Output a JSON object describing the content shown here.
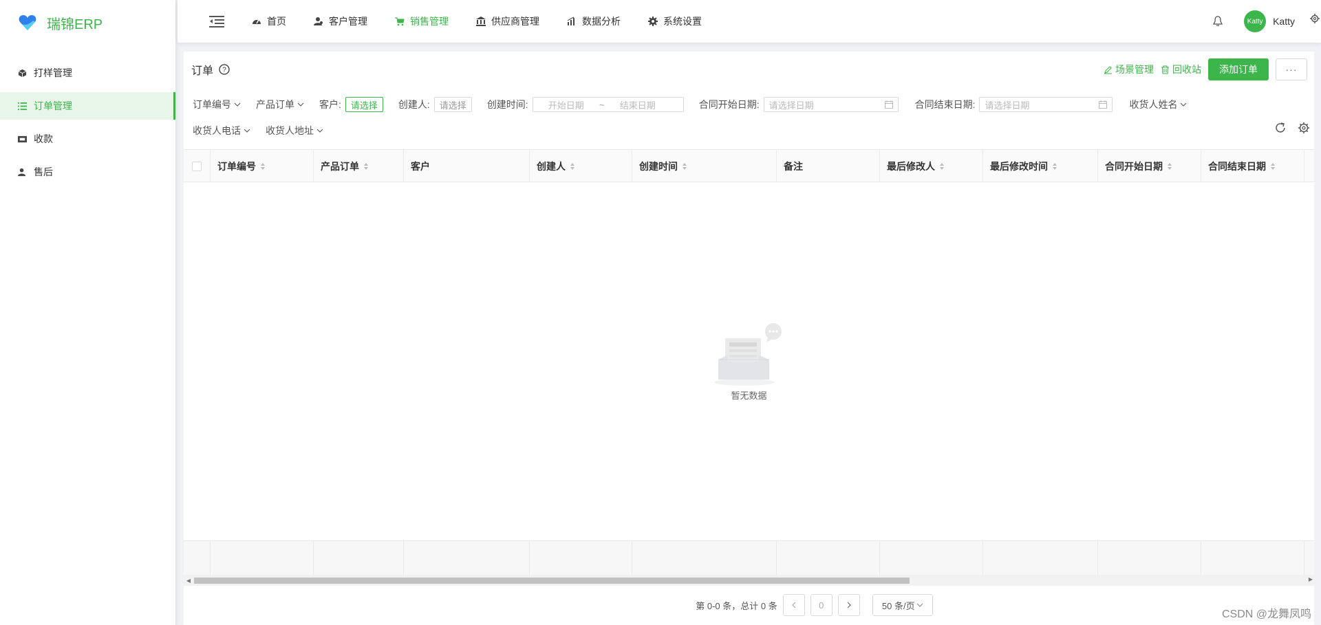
{
  "brand": {
    "name": "瑞锦ERP",
    "color": "#3cb54a"
  },
  "sidebar": {
    "items": [
      {
        "label": "打样管理",
        "icon": "cube-icon",
        "active": false
      },
      {
        "label": "订单管理",
        "icon": "list-icon",
        "active": true
      },
      {
        "label": "收款",
        "icon": "cash-icon",
        "active": false
      },
      {
        "label": "售后",
        "icon": "user-icon",
        "active": false
      }
    ]
  },
  "topnav": {
    "items": [
      {
        "label": "首页",
        "icon": "dashboard-icon",
        "active": false
      },
      {
        "label": "客户管理",
        "icon": "users-icon",
        "active": false
      },
      {
        "label": "销售管理",
        "icon": "cart-icon",
        "active": true
      },
      {
        "label": "供应商管理",
        "icon": "bank-icon",
        "active": false
      },
      {
        "label": "数据分析",
        "icon": "bar-chart-icon",
        "active": false
      },
      {
        "label": "系统设置",
        "icon": "gear-icon",
        "active": false
      }
    ],
    "user": {
      "avatar_text": "Katty",
      "name": "Katty"
    }
  },
  "card": {
    "title": "订单",
    "actions": {
      "scene": "场景管理",
      "recycle": "回收站",
      "add": "添加订单",
      "more": "···"
    }
  },
  "filters": {
    "order_no": "订单编号",
    "product_order": "产品订单",
    "customer_label": "客户:",
    "customer_placeholder": "请选择",
    "creator_label": "创建人:",
    "creator_placeholder": "请选择",
    "created_time_label": "创建时间:",
    "start_date": "开始日期",
    "range_sep": "~",
    "end_date": "结束日期",
    "contract_start_label": "合同开始日期:",
    "contract_start_placeholder": "请选择日期",
    "contract_end_label": "合同结束日期:",
    "contract_end_placeholder": "请选择日期",
    "receiver_name": "收货人姓名",
    "receiver_phone": "收货人电话",
    "receiver_address": "收货人地址"
  },
  "table": {
    "columns": [
      "订单编号",
      "产品订单",
      "客户",
      "创建人",
      "创建时间",
      "备注",
      "最后修改人",
      "最后修改时间",
      "合同开始日期",
      "合同结束日期"
    ],
    "empty_text": "暂无数据"
  },
  "pagination": {
    "summary": "第 0-0 条，总计 0 条",
    "page": "0",
    "page_size": "50 条/页"
  },
  "watermark": "CSDN @龙舞凤鸣"
}
